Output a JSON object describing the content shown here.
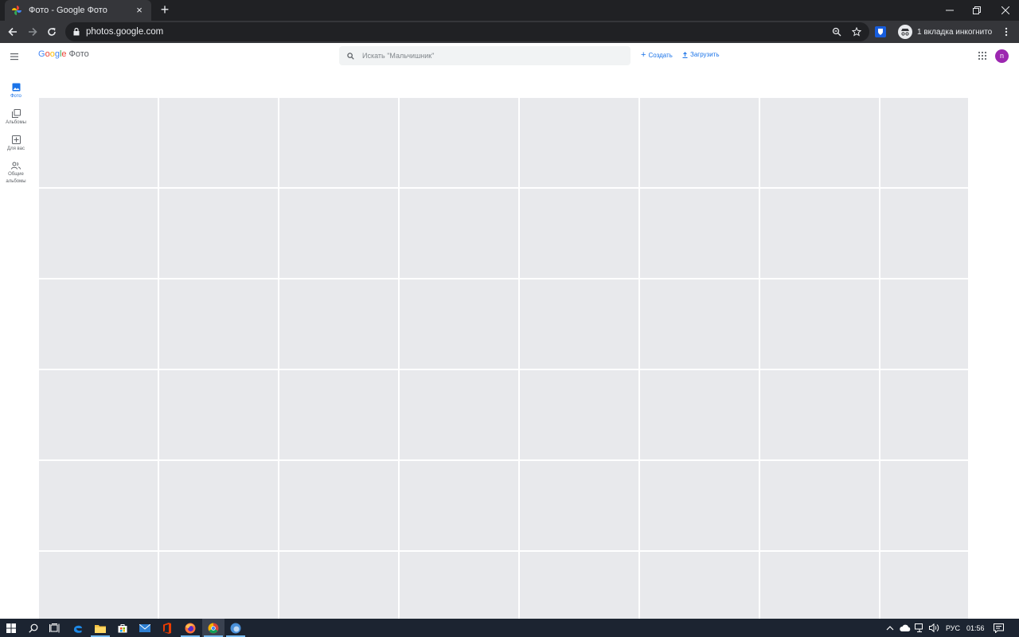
{
  "browser": {
    "tab_title": "Фото - Google Фото",
    "tab_close": "×",
    "new_tab": "+",
    "url": "photos.google.com",
    "incognito_label": "1 вкладка инкогнито"
  },
  "header": {
    "logo_google": [
      "G",
      "o",
      "o",
      "g",
      "l",
      "e"
    ],
    "logo_colors": [
      "#4285f4",
      "#ea4335",
      "#fbbc05",
      "#4285f4",
      "#34a853",
      "#ea4335"
    ],
    "logo_product": "Фото",
    "search_placeholder": "Искать \"Мальчишник\"",
    "create_label": "Создать",
    "upload_label": "Загрузить",
    "avatar_letter": "n",
    "accent_color": "#1a73e8"
  },
  "nav": {
    "items": [
      {
        "label": "Фото",
        "icon": "photo-icon",
        "active": true
      },
      {
        "label": "Альбомы",
        "icon": "albums-icon",
        "active": false
      },
      {
        "label": "Для вас",
        "icon": "assistant-icon",
        "active": false
      },
      {
        "label": "Общие альбомы",
        "icon": "shared-icon",
        "active": false
      }
    ]
  },
  "taskbar": {
    "language": "РУС",
    "time": "01:56"
  }
}
